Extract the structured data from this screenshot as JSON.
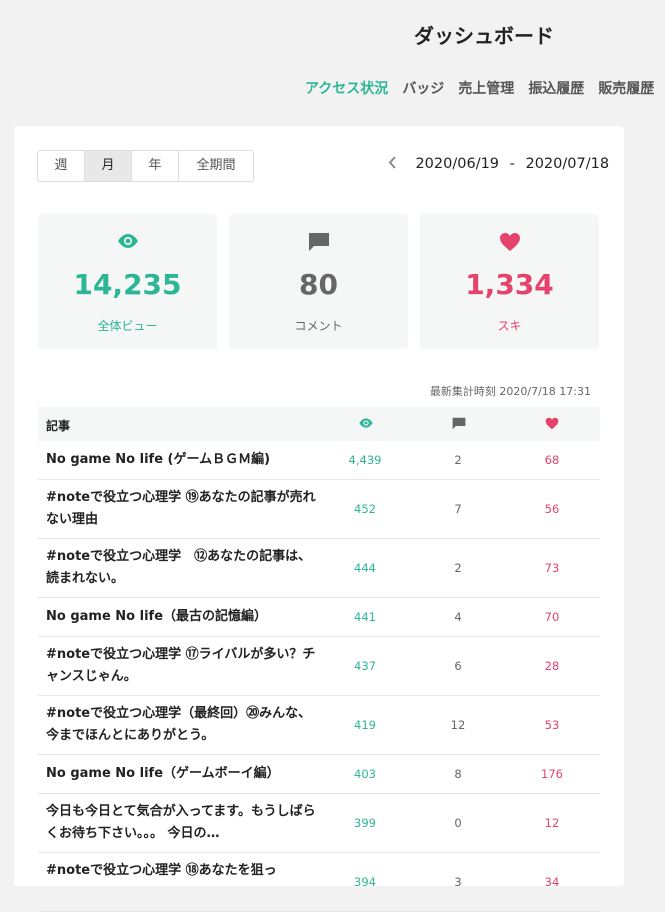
{
  "header": {
    "title": "ダッシュボード"
  },
  "nav": {
    "tabs": [
      {
        "label": "アクセス状況"
      },
      {
        "label": "バッジ"
      },
      {
        "label": "売上管理"
      },
      {
        "label": "振込履歴"
      },
      {
        "label": "販売履歴"
      }
    ]
  },
  "period": {
    "tabs": [
      {
        "label": "週"
      },
      {
        "label": "月"
      },
      {
        "label": "年"
      },
      {
        "label": "全期間"
      }
    ],
    "selected": "月",
    "start": "2020/06/19",
    "separator": "-",
    "end": "2020/07/18"
  },
  "stats": {
    "views": {
      "value": "14,235",
      "label": "全体ビュー"
    },
    "comments": {
      "value": "80",
      "label": "コメント"
    },
    "likes": {
      "value": "1,334",
      "label": "スキ"
    }
  },
  "updated": "最新集計時刻 2020/7/18 17:31",
  "table": {
    "header_title": "記事",
    "rows": [
      {
        "title": "No game No life (ゲームＢＧＭ編)",
        "views": "4,439",
        "comments": "2",
        "likes": "68"
      },
      {
        "title": "#noteで役立つ心理学 ⑲あなたの記事が売れない理由",
        "views": "452",
        "comments": "7",
        "likes": "56"
      },
      {
        "title": "#noteで役立つ心理学　⑫あなたの記事は、読まれない。",
        "views": "444",
        "comments": "2",
        "likes": "73"
      },
      {
        "title": "No game No life（最古の記憶編）",
        "views": "441",
        "comments": "4",
        "likes": "70"
      },
      {
        "title": "#noteで役立つ心理学 ⑰ライバルが多い？チャンスじゃん。",
        "views": "437",
        "comments": "6",
        "likes": "28"
      },
      {
        "title": "#noteで役立つ心理学（最終回）⑳みんな、今までほんとにありがとう。",
        "views": "419",
        "comments": "12",
        "likes": "53"
      },
      {
        "title": "No game No life（ゲームボーイ編）",
        "views": "403",
        "comments": "8",
        "likes": "176"
      },
      {
        "title": "今日も今日とて気合が入ってます。もうしばらくお待ち下さい。。。 今日の…",
        "views": "399",
        "comments": "0",
        "likes": "12"
      },
      {
        "title": "#noteで役立つ心理学 ⑱あなたを狙っ",
        "views": "394",
        "comments": "3",
        "likes": "34"
      }
    ]
  }
}
